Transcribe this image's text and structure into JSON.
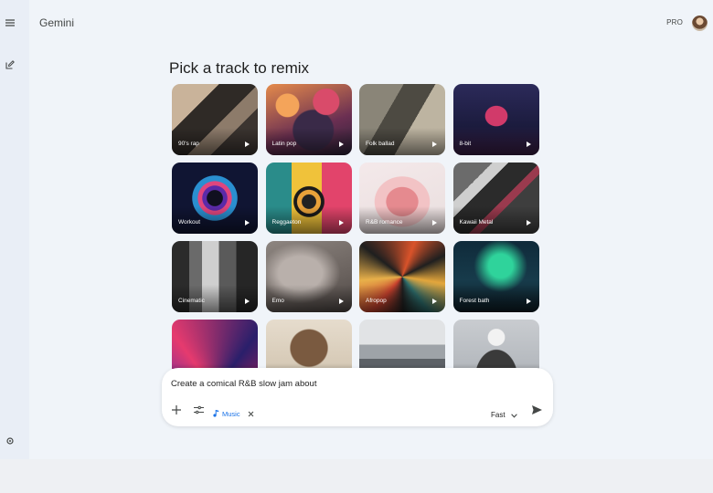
{
  "app": {
    "title": "Gemini",
    "plan_badge": "PRO"
  },
  "sidebar": {
    "icons": [
      "menu-icon",
      "edit-icon",
      "settings-icon"
    ]
  },
  "main": {
    "heading": "Pick a track to remix",
    "tracks": [
      {
        "label": "90's rap"
      },
      {
        "label": "Latin pop"
      },
      {
        "label": "Folk ballad"
      },
      {
        "label": "8-bit"
      },
      {
        "label": "Workout"
      },
      {
        "label": "Reggaeton"
      },
      {
        "label": "R&B romance"
      },
      {
        "label": "Kawaii Metal"
      },
      {
        "label": "Cinematic"
      },
      {
        "label": "Emo"
      },
      {
        "label": "Afropop"
      },
      {
        "label": "Forest bath"
      },
      {
        "label": ""
      },
      {
        "label": ""
      },
      {
        "label": ""
      },
      {
        "label": ""
      }
    ]
  },
  "composer": {
    "input_text": "Create a comical R&B slow jam about",
    "chip_label": "Music",
    "model_label": "Fast"
  },
  "colors": {
    "accent": "#1a73e8",
    "background": "#f0f4f9",
    "sidebar": "#e9eef6"
  }
}
